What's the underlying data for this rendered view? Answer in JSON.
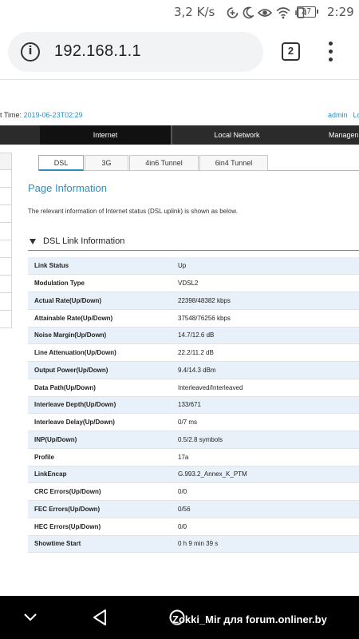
{
  "status_bar": {
    "net_speed": "3,2 K/s",
    "battery": "27",
    "time": "2:29",
    "icons": [
      "data-saver-icon",
      "moon-icon",
      "eye-icon",
      "wifi-icon",
      "vibrate-icon",
      "battery-icon"
    ]
  },
  "browser": {
    "url": "192.168.1.1",
    "tab_count": "2",
    "icons": [
      "info-icon",
      "tabs-icon",
      "overflow-menu-icon"
    ]
  },
  "router": {
    "uptime_label": "t Time:",
    "uptime_value": "2019-06-23T02:29",
    "user": "admin",
    "logout": "Lo",
    "main_nav": [
      {
        "label": "Internet",
        "active": true
      },
      {
        "label": "Local Network",
        "active": false
      },
      {
        "label": "Managen",
        "active": false
      }
    ],
    "sub_tabs": [
      {
        "label": "DSL",
        "active": true
      },
      {
        "label": "3G",
        "active": false
      },
      {
        "label": "4in6 Tunnel",
        "active": false
      },
      {
        "label": "6in4 Tunnel",
        "active": false
      }
    ],
    "page_title": "Page Information",
    "page_desc": "The relevant information of Internet status (DSL uplink) is shown as below.",
    "section_title": "DSL Link Information",
    "dsl_rows": [
      {
        "label": "Link Status",
        "value": "Up"
      },
      {
        "label": "Modulation Type",
        "value": "VDSL2"
      },
      {
        "label": "Actual Rate(Up/Down)",
        "value": "22398/48382 kbps"
      },
      {
        "label": "Attainable Rate(Up/Down)",
        "value": "37548/76256 kbps"
      },
      {
        "label": "Noise Margin(Up/Down)",
        "value": "14.7/12.6 dB"
      },
      {
        "label": "Line Attenuation(Up/Down)",
        "value": "22.2/11.2 dB"
      },
      {
        "label": "Output Power(Up/Down)",
        "value": "9.4/14.3 dBm"
      },
      {
        "label": "Data Path(Up/Down)",
        "value": "Interleaved/Interleaved"
      },
      {
        "label": "Interleave Depth(Up/Down)",
        "value": "133/671"
      },
      {
        "label": "Interleave Delay(Up/Down)",
        "value": "0/7 ms"
      },
      {
        "label": "INP(Up/Down)",
        "value": "0.5/2.8 symbols"
      },
      {
        "label": "Profile",
        "value": "17a"
      },
      {
        "label": "LinkEncap",
        "value": "G.993.2_Annex_K_PTM"
      },
      {
        "label": "CRC Errors(Up/Down)",
        "value": "0/0"
      },
      {
        "label": "FEC Errors(Up/Down)",
        "value": "0/56"
      },
      {
        "label": "HEC Errors(Up/Down)",
        "value": "0/0"
      },
      {
        "label": "Showtime Start",
        "value": "0 h 9 min 39 s"
      }
    ]
  },
  "nav_bar": {
    "icons": [
      "hide-keyboard-icon",
      "back-icon",
      "home-icon"
    ],
    "watermark": "Zokki_Mir для forum.onliner.by"
  }
}
